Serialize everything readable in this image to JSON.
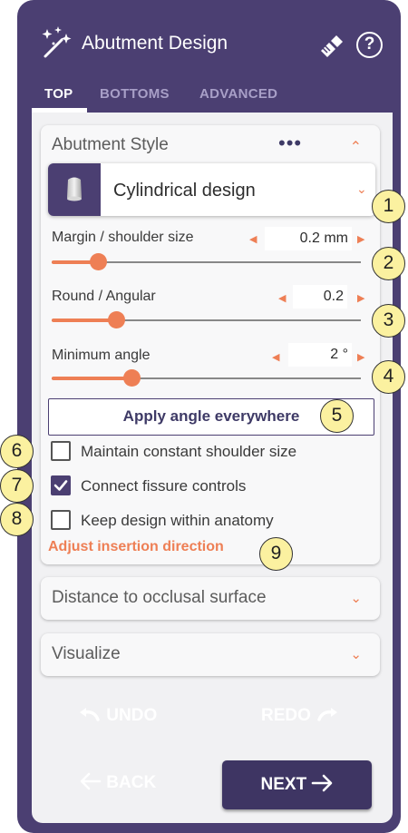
{
  "header": {
    "title": "Abutment Design",
    "wand_icon": "magic-wand-icon",
    "brush_icon": "brush-icon",
    "help_label": "?"
  },
  "tabs": [
    {
      "label": "TOP",
      "active": true
    },
    {
      "label": "BOTTOMS",
      "active": false
    },
    {
      "label": "ADVANCED",
      "active": false
    }
  ],
  "abutment_style": {
    "title": "Abutment Style",
    "more_label": "•••",
    "collapse_chevron": "⌃",
    "design": {
      "value": "Cylindrical design",
      "chevron": "⌄"
    },
    "sliders": [
      {
        "label": "Margin / shoulder size",
        "value": "0.2 mm",
        "fraction": 0.15
      },
      {
        "label": "Round / Angular",
        "value": "0.2",
        "fraction": 0.21
      },
      {
        "label": "Minimum angle",
        "value": "2 °",
        "fraction": 0.26
      }
    ],
    "apply_label": "Apply angle everywhere",
    "checkboxes": [
      {
        "label": "Maintain constant shoulder size",
        "checked": false
      },
      {
        "label": "Connect fissure controls",
        "checked": true
      },
      {
        "label": "Keep design within anatomy",
        "checked": false
      }
    ],
    "adjust_link": "Adjust insertion direction"
  },
  "sections": [
    {
      "title": "Distance to occlusal surface",
      "chevron": "⌄"
    },
    {
      "title": "Visualize",
      "chevron": "⌄"
    }
  ],
  "footer": {
    "undo_label": "UNDO",
    "redo_label": "REDO",
    "back_label": "BACK",
    "next_label": "NEXT"
  },
  "callouts": [
    "1",
    "2",
    "3",
    "4",
    "5",
    "6",
    "7",
    "8",
    "9"
  ],
  "colors": {
    "brand_purple": "#4b3f72",
    "accent_orange": "#ee7f55",
    "callout_yellow": "#fbf1a0"
  }
}
